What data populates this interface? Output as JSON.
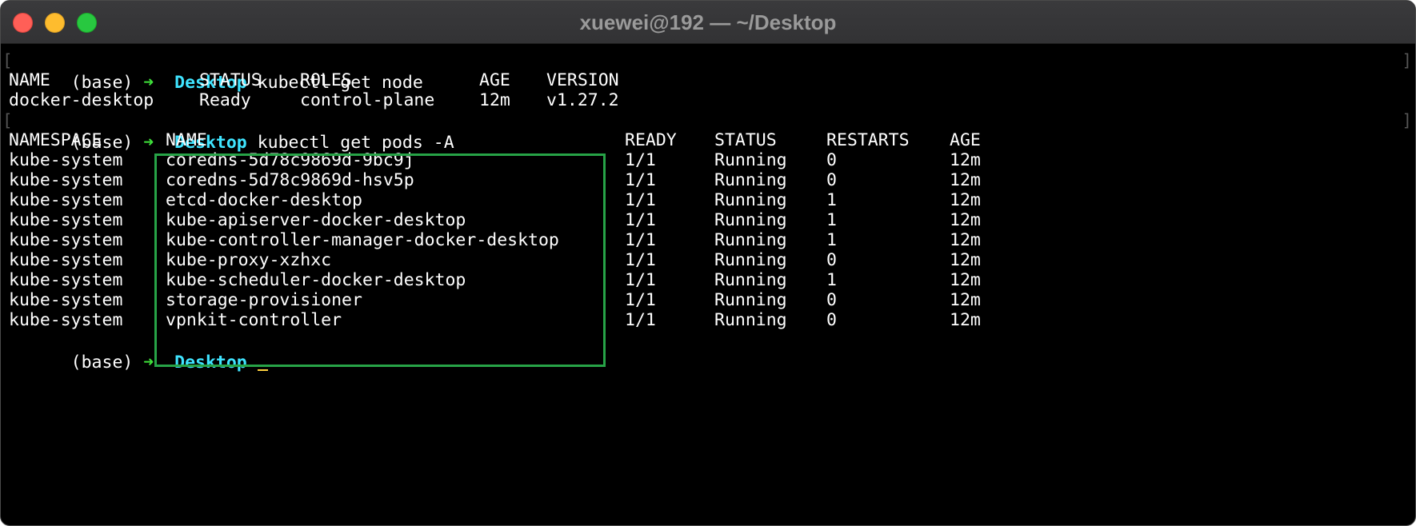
{
  "window": {
    "title": "xuewei@192 — ~/Desktop"
  },
  "colors": {
    "background": "#000000",
    "prompt_arrow": "#3ee03a",
    "prompt_dir": "#3fe4ff",
    "cursor": "#ffd23f",
    "highlight_box": "#27a347"
  },
  "prompt": {
    "env": "(base)",
    "arrow": "➜",
    "dir": "Desktop"
  },
  "commands": {
    "first": "kubectl get node",
    "second": "kubectl get pods -A"
  },
  "nodes": {
    "headers": [
      "NAME",
      "STATUS",
      "ROLES",
      "AGE",
      "VERSION"
    ],
    "rows": [
      [
        "docker-desktop",
        "Ready",
        "control-plane",
        "12m",
        "v1.27.2"
      ]
    ]
  },
  "pods": {
    "headers": [
      "NAMESPACE",
      "NAME",
      "READY",
      "STATUS",
      "RESTARTS",
      "AGE"
    ],
    "rows": [
      [
        "kube-system",
        "coredns-5d78c9869d-9bc9j",
        "1/1",
        "Running",
        "0",
        "12m"
      ],
      [
        "kube-system",
        "coredns-5d78c9869d-hsv5p",
        "1/1",
        "Running",
        "0",
        "12m"
      ],
      [
        "kube-system",
        "etcd-docker-desktop",
        "1/1",
        "Running",
        "1",
        "12m"
      ],
      [
        "kube-system",
        "kube-apiserver-docker-desktop",
        "1/1",
        "Running",
        "1",
        "12m"
      ],
      [
        "kube-system",
        "kube-controller-manager-docker-desktop",
        "1/1",
        "Running",
        "1",
        "12m"
      ],
      [
        "kube-system",
        "kube-proxy-xzhxc",
        "1/1",
        "Running",
        "0",
        "12m"
      ],
      [
        "kube-system",
        "kube-scheduler-docker-desktop",
        "1/1",
        "Running",
        "1",
        "12m"
      ],
      [
        "kube-system",
        "storage-provisioner",
        "1/1",
        "Running",
        "0",
        "12m"
      ],
      [
        "kube-system",
        "vpnkit-controller",
        "1/1",
        "Running",
        "0",
        "12m"
      ]
    ]
  }
}
